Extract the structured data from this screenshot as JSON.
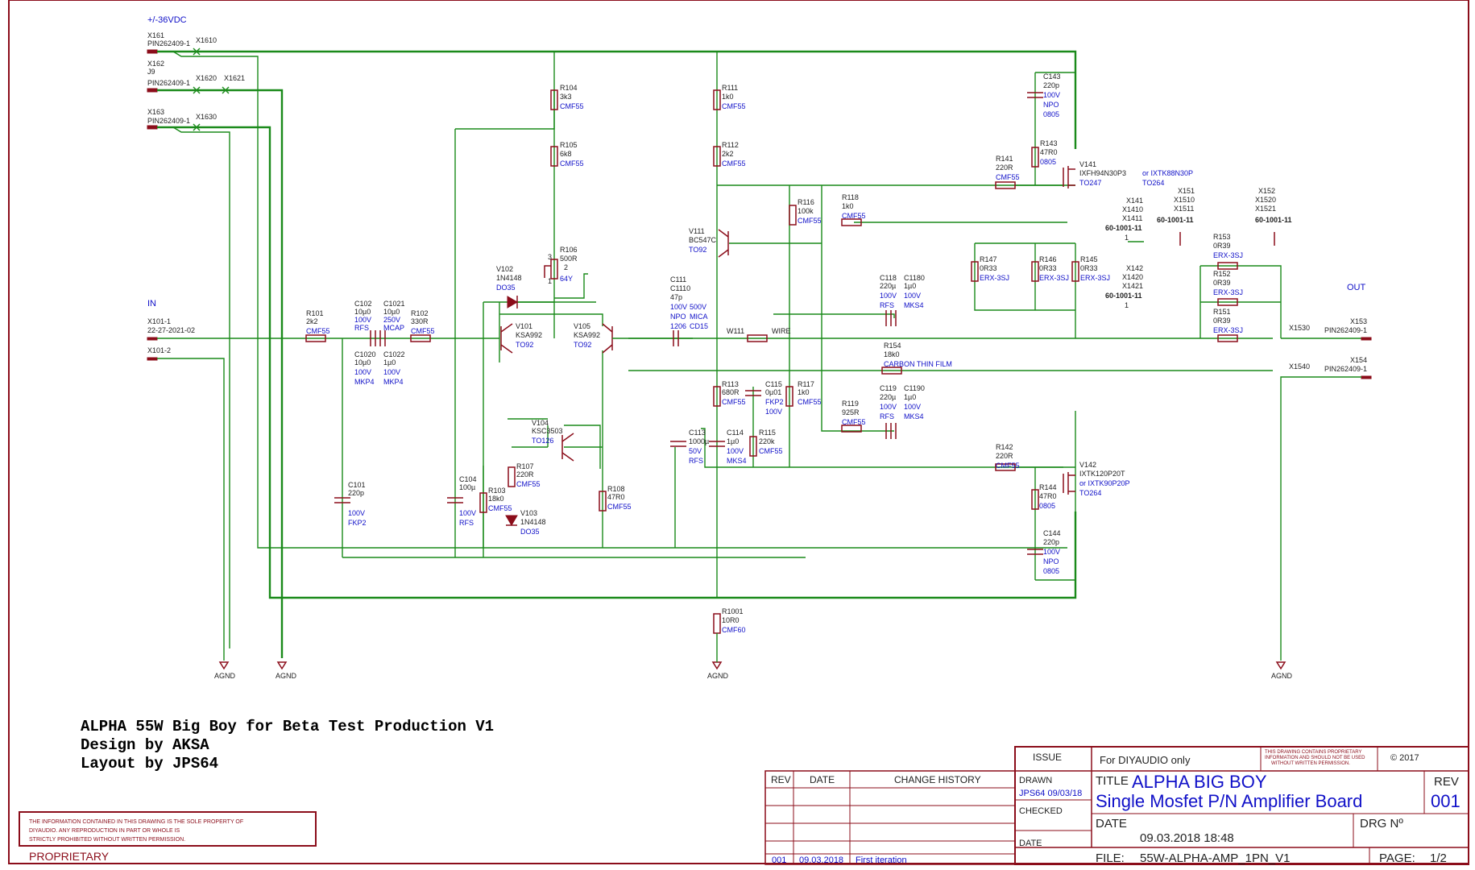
{
  "supply_label": "+/-36VDC",
  "in_label": "IN",
  "out_label": "OUT",
  "connectors": {
    "x161": {
      "ref": "X161",
      "part": "PIN262409-1",
      "x": "X1610"
    },
    "x162": {
      "ref": "X162",
      "part": "J9",
      "part2": "PIN262409-1",
      "x1": "X1620",
      "x2": "X1621"
    },
    "x163": {
      "ref": "X163",
      "part": "PIN262409-1",
      "x": "X1630"
    },
    "x101": {
      "ref": "X101-1",
      "part": "22-27-2021-02",
      "ref2": "X101-2"
    },
    "x141": {
      "r1": "X141",
      "r2": "X1410",
      "r3": "X1411",
      "part": "60-1001-11",
      "pin": "1"
    },
    "x142": {
      "r1": "X142",
      "r2": "X1420",
      "r3": "X1421",
      "part": "60-1001-11",
      "pin": "1"
    },
    "x151": {
      "r1": "X151",
      "r2": "X1510",
      "r3": "X1511",
      "part": "60-1001-11"
    },
    "x152": {
      "r1": "X152",
      "r2": "X1520",
      "r3": "X1521",
      "part": "60-1001-11"
    },
    "x153": {
      "ref": "X153",
      "part": "PIN262409-1",
      "x": "X1530"
    },
    "x154": {
      "ref": "X154",
      "part": "PIN262409-1",
      "x": "X1540"
    }
  },
  "gnd": "AGND",
  "components": {
    "r101": [
      "R101",
      "2k2",
      "CMF55"
    ],
    "r102": [
      "R102",
      "330R",
      "CMF55"
    ],
    "c102": [
      "C102",
      "10µ0",
      "100V",
      "RFS"
    ],
    "c1021": [
      "C1021",
      "10µ0",
      "250V",
      "MCAP"
    ],
    "c1020": [
      "C1020",
      "10µ0",
      "100V",
      "MKP4"
    ],
    "c1022": [
      "C1022",
      "1µ0",
      "100V",
      "MKP4"
    ],
    "c101": [
      "C101",
      "220p",
      "100V",
      "FKP2"
    ],
    "r104": [
      "R104",
      "3k3",
      "CMF55"
    ],
    "r105": [
      "R105",
      "6k8",
      "CMF55"
    ],
    "r106": [
      "R106",
      "500R",
      "64Y",
      "2",
      "3",
      "1"
    ],
    "v102": [
      "V102",
      "1N4148",
      "DO35"
    ],
    "v101": [
      "V101",
      "KSA992",
      "TO92"
    ],
    "v105": [
      "V105",
      "KSA992",
      "TO92"
    ],
    "v104": [
      "V104",
      "KSC3503",
      "TO126"
    ],
    "r107": [
      "R107",
      "220R",
      "CMF55"
    ],
    "r103": [
      "R103",
      "18k0",
      "CMF55"
    ],
    "c104": [
      "C104",
      "100µ",
      "100V",
      "RFS"
    ],
    "v103": [
      "V103",
      "1N4148",
      "DO35"
    ],
    "r108": [
      "R108",
      "47R0",
      "CMF55"
    ],
    "c111": [
      "C111",
      "C1110",
      "47p",
      "100V",
      "500V",
      "NPO",
      "MICA",
      "1206",
      "CD15"
    ],
    "r111": [
      "R111",
      "1k0",
      "CMF55"
    ],
    "r112": [
      "R112",
      "2k2",
      "CMF55"
    ],
    "v111": [
      "V111",
      "BC547C",
      "TO92"
    ],
    "w111": [
      "W111",
      "WIRE"
    ],
    "r113": [
      "R113",
      "680R",
      "CMF55"
    ],
    "c115": [
      "C115",
      "0µ01",
      "FKP2",
      "100V"
    ],
    "r117": [
      "R117",
      "1k0",
      "CMF55"
    ],
    "c113": [
      "C113",
      "1000µ",
      "50V",
      "RFS"
    ],
    "c114": [
      "C114",
      "1µ0",
      "100V",
      "MKS4"
    ],
    "r115": [
      "R115",
      "220k",
      "CMF55"
    ],
    "r1001": [
      "R1001",
      "10R0",
      "CMF60"
    ],
    "r116": [
      "R116",
      "100k",
      "CMF55"
    ],
    "r118": [
      "R118",
      "1k0",
      "CMF55"
    ],
    "c118": [
      "C118",
      "C1180",
      "220µ",
      "1µ0",
      "100V",
      "100V",
      "RFS",
      "MKS4"
    ],
    "r154": [
      "R154",
      "18k0",
      "CARBON THIN FILM"
    ],
    "r119": [
      "R119",
      "925R",
      "CMF55"
    ],
    "c119": [
      "C119",
      "C1190",
      "220µ",
      "1µ0",
      "100V",
      "100V",
      "RFS",
      "MKS4"
    ],
    "c143": [
      "C143",
      "220p",
      "100V",
      "NPO",
      "0805"
    ],
    "r143": [
      "R143",
      "47R0",
      "0805"
    ],
    "r141": [
      "R141",
      "220R",
      "CMF55"
    ],
    "v141": [
      "V141",
      "IXFH94N30P3",
      "TO247",
      "or IXTK88N30P",
      "TO264"
    ],
    "r147": [
      "R147",
      "0R33",
      "ERX-3SJ"
    ],
    "r146": [
      "R146",
      "0R33",
      "ERX-3SJ"
    ],
    "r145": [
      "R145",
      "0R33",
      "ERX-3SJ"
    ],
    "r153": [
      "R153",
      "0R39",
      "ERX-3SJ"
    ],
    "r152": [
      "R152",
      "0R39",
      "ERX-3SJ"
    ],
    "r151": [
      "R151",
      "0R39",
      "ERX-3SJ"
    ],
    "r142": [
      "R142",
      "220R",
      "CMF55"
    ],
    "v142": [
      "V142",
      "IXTK120P20T",
      "or IXTK90P20P",
      "TO264"
    ],
    "r144": [
      "R144",
      "47R0",
      "0805"
    ],
    "c144": [
      "C144",
      "220p",
      "100V",
      "NPO",
      "0805"
    ]
  },
  "credits": {
    "line1": "ALPHA 55W Big Boy for Beta Test Production V1",
    "line2": "Design by AKSA",
    "line3": "Layout by JPS64"
  },
  "proprietary": {
    "text1": "THE INFORMATION CONTAINED IN THIS DRAWING IS THE SOLE PROPERTY OF",
    "text2": "DIYAUDIO.  ANY REPRODUCTION IN PART OR WHOLE IS",
    "text3": "STRICTLY PROHIBITED WITHOUT WRITTEN PERMISSION.",
    "label": "PROPRIETARY"
  },
  "rev_table": {
    "headers": [
      "REV",
      "DATE",
      "CHANGE HISTORY"
    ],
    "rows": [
      [
        "001",
        "09.03.2018",
        "First iteration"
      ]
    ]
  },
  "title_block": {
    "issue_label": "ISSUE",
    "issue_value": "For DIYAUDIO only",
    "notice1": "THIS DRAWING CONTAINS PROPRIETARY",
    "notice2": "INFORMATION AND SHOULD NOT BE USED",
    "notice3": "WITHOUT WRITTEN PERMISSION.",
    "copyright": "© 2017",
    "drawn_label": "DRAWN",
    "drawn_value": "JPS64 09/03/18",
    "checked_label": "CHECKED",
    "date_label_left": "DATE",
    "title_label": "TITLE",
    "title_line1": "ALPHA BIG BOY",
    "title_line2": "Single Mosfet P/N Amplifier Board",
    "rev_label": "REV",
    "rev_value": "001",
    "date_label": "DATE",
    "date_value": "09.03.2018 18:48",
    "drg_label": "DRG Nº",
    "file_label": "FILE:",
    "file_value": "55W-ALPHA-AMP_1PN_V1",
    "page_label": "PAGE:",
    "page_value": "1/2"
  }
}
